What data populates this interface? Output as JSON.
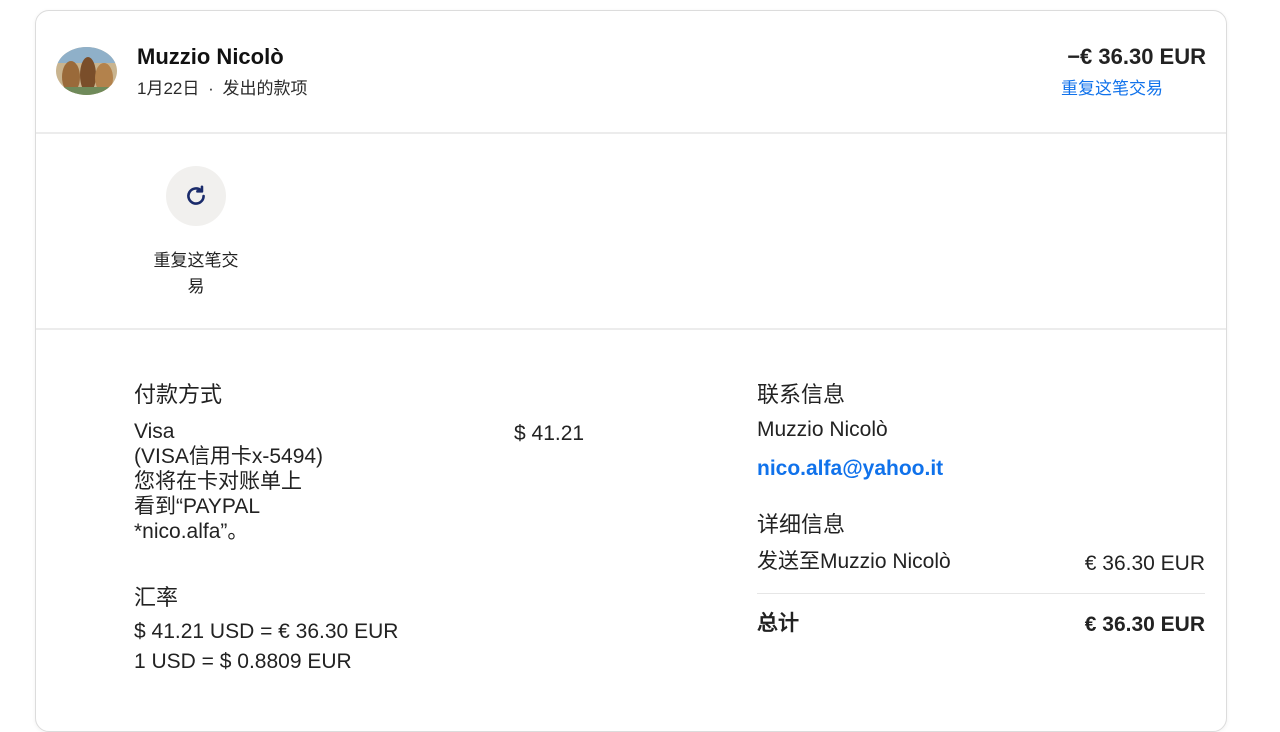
{
  "header": {
    "name": "Muzzio Nicolò",
    "date": "1月22日",
    "separator": "·",
    "type": "发出的款项",
    "amount": "−€ 36.30 EUR",
    "repeat_link": "重复这笔交易"
  },
  "action": {
    "label": "重复这笔交易",
    "icon": "refresh-icon"
  },
  "payment_method": {
    "title": "付款方式",
    "card": "Visa",
    "card_detail": "(VISA信用卡x-5494)",
    "statement_note": "您将在卡对账单上看到“PAYPAL *nico.alfa”。",
    "amount": "$ 41.21"
  },
  "exchange": {
    "title": "汇率",
    "line1": "$ 41.21 USD = € 36.30 EUR",
    "line2": "1 USD = $ 0.8809 EUR"
  },
  "contact": {
    "title": "联系信息",
    "name": "Muzzio Nicolò",
    "email": "nico.alfa@yahoo.it"
  },
  "details": {
    "title": "详细信息",
    "sent_to_label": "发送至Muzzio Nicolò",
    "sent_to_amount": "€ 36.30 EUR",
    "total_label": "总计",
    "total_amount": "€ 36.30 EUR"
  },
  "colors": {
    "link": "#1072eb",
    "icon": "#1a2b6b"
  }
}
